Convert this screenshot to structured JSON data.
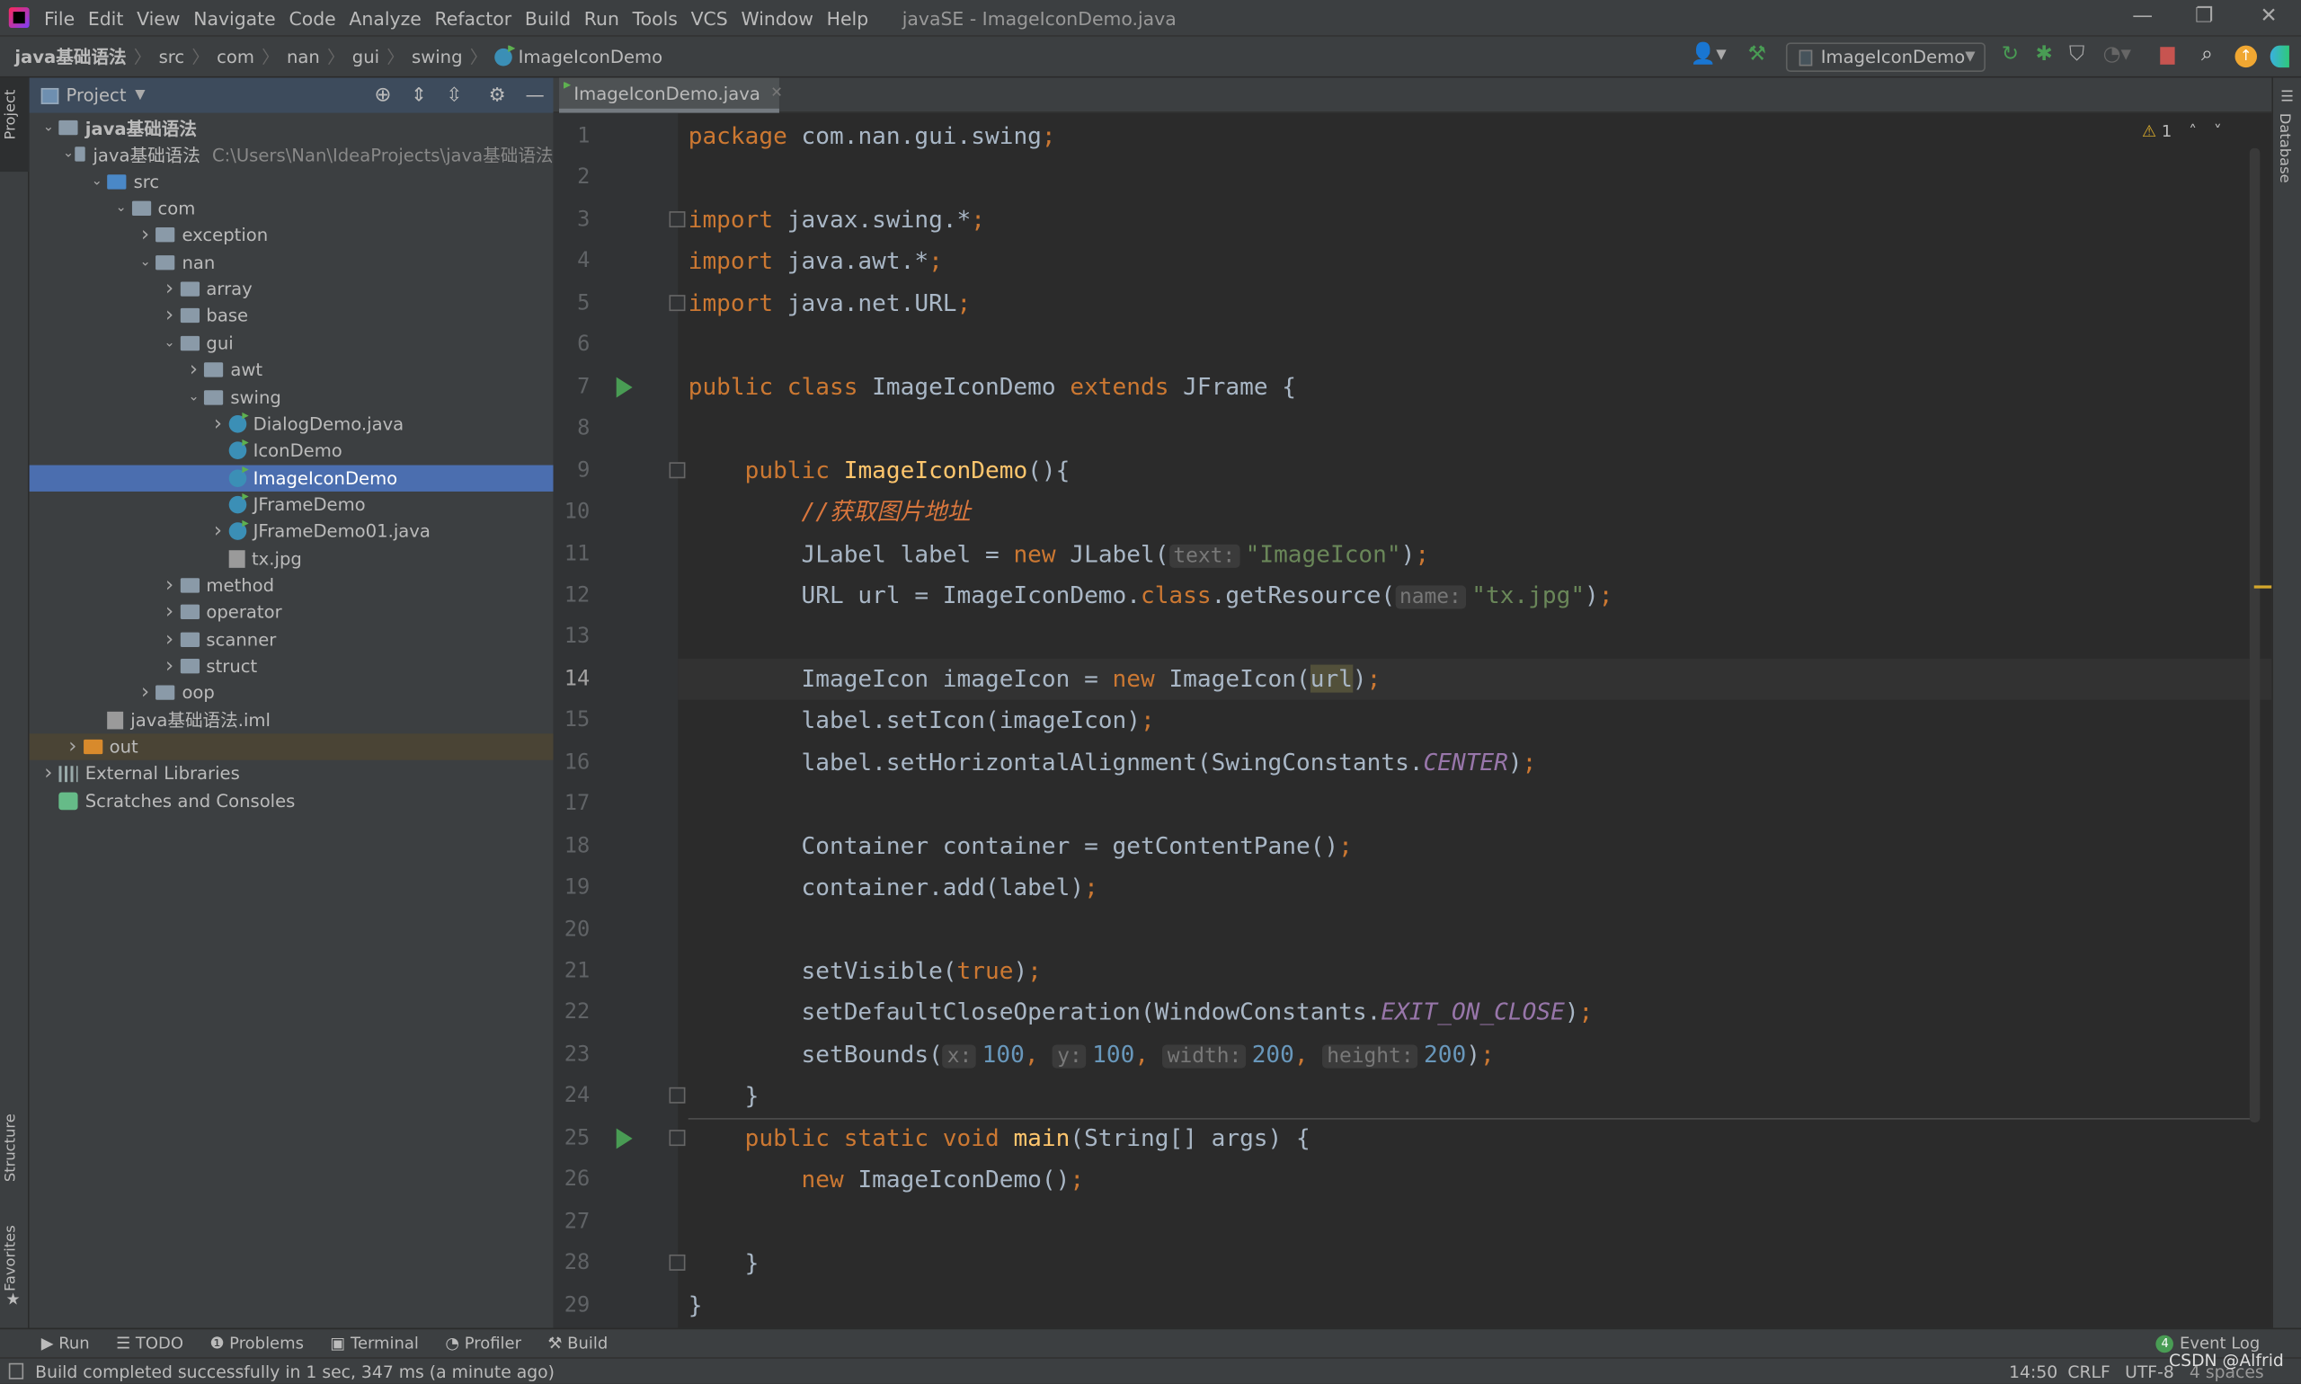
{
  "window": {
    "title": "javaSE - ImageIconDemo.java",
    "menu": [
      "File",
      "Edit",
      "View",
      "Navigate",
      "Code",
      "Analyze",
      "Refactor",
      "Build",
      "Run",
      "Tools",
      "VCS",
      "Window",
      "Help"
    ]
  },
  "breadcrumb": [
    "java基础语法",
    "src",
    "com",
    "nan",
    "gui",
    "swing",
    "ImageIconDemo"
  ],
  "toolbar": {
    "run_config": "ImageIconDemo",
    "accent": "#499c54",
    "stop_color": "#c75450",
    "update_color": "#f0a732"
  },
  "left_strip": {
    "project": "Project",
    "structure": "Structure",
    "favorites": "Favorites"
  },
  "right_strip": {
    "database": "Database"
  },
  "project": {
    "title": "Project",
    "tree": [
      {
        "label": "java基础语法",
        "depth": 0,
        "arrow": "open",
        "icon": "module-folder",
        "bold": true
      },
      {
        "label": "java基础语法",
        "sub": "C:\\Users\\Nan\\IdeaProjects\\java基础语法",
        "depth": 1,
        "arrow": "open",
        "icon": "module-folder"
      },
      {
        "label": "src",
        "depth": 2,
        "arrow": "open",
        "icon": "source-folder"
      },
      {
        "label": "com",
        "depth": 3,
        "arrow": "open",
        "icon": "package"
      },
      {
        "label": "exception",
        "depth": 4,
        "arrow": "closed",
        "icon": "package"
      },
      {
        "label": "nan",
        "depth": 4,
        "arrow": "open",
        "icon": "package"
      },
      {
        "label": "array",
        "depth": 5,
        "arrow": "closed",
        "icon": "package"
      },
      {
        "label": "base",
        "depth": 5,
        "arrow": "closed",
        "icon": "package"
      },
      {
        "label": "gui",
        "depth": 5,
        "arrow": "open",
        "icon": "package"
      },
      {
        "label": "awt",
        "depth": 6,
        "arrow": "closed",
        "icon": "package"
      },
      {
        "label": "swing",
        "depth": 6,
        "arrow": "open",
        "icon": "package"
      },
      {
        "label": "DialogDemo.java",
        "depth": 7,
        "arrow": "closed",
        "icon": "class"
      },
      {
        "label": "IconDemo",
        "depth": 7,
        "arrow": "",
        "icon": "class"
      },
      {
        "label": "ImageIconDemo",
        "depth": 7,
        "arrow": "",
        "icon": "class",
        "selected": true
      },
      {
        "label": "JFrameDemo",
        "depth": 7,
        "arrow": "",
        "icon": "class"
      },
      {
        "label": "JFrameDemo01.java",
        "depth": 7,
        "arrow": "closed",
        "icon": "class"
      },
      {
        "label": "tx.jpg",
        "depth": 7,
        "arrow": "",
        "icon": "image-file"
      },
      {
        "label": "method",
        "depth": 5,
        "arrow": "closed",
        "icon": "package"
      },
      {
        "label": "operator",
        "depth": 5,
        "arrow": "closed",
        "icon": "package"
      },
      {
        "label": "scanner",
        "depth": 5,
        "arrow": "closed",
        "icon": "package"
      },
      {
        "label": "struct",
        "depth": 5,
        "arrow": "closed",
        "icon": "package"
      },
      {
        "label": "oop",
        "depth": 4,
        "arrow": "closed",
        "icon": "package"
      },
      {
        "label": "java基础语法.iml",
        "depth": 2,
        "arrow": "",
        "icon": "iml-file"
      },
      {
        "label": "out",
        "depth": 1,
        "arrow": "closed",
        "icon": "excluded-folder",
        "out": true
      },
      {
        "label": "External Libraries",
        "depth": 0,
        "arrow": "closed",
        "icon": "library"
      },
      {
        "label": "Scratches and Consoles",
        "depth": 0,
        "arrow": "",
        "icon": "scratches"
      }
    ]
  },
  "editor": {
    "tab": "ImageIconDemo.java",
    "warnings": "1",
    "current_line": 14,
    "lines": [
      [
        [
          "package",
          "kw"
        ],
        [
          " com.nan.gui.swing",
          ""
        ],
        [
          ";",
          "kw"
        ]
      ],
      [],
      [
        [
          "import",
          "kw"
        ],
        [
          " javax.swing.*",
          ""
        ],
        [
          ";",
          "kw"
        ]
      ],
      [
        [
          "import",
          "kw"
        ],
        [
          " java.awt.*",
          ""
        ],
        [
          ";",
          "kw"
        ]
      ],
      [
        [
          "import",
          "kw"
        ],
        [
          " java.net.URL",
          ""
        ],
        [
          ";",
          "kw"
        ]
      ],
      [],
      [
        [
          "public class",
          "kw"
        ],
        [
          " ImageIconDemo ",
          ""
        ],
        [
          "extends",
          "kw"
        ],
        [
          " JFrame {",
          ""
        ]
      ],
      [],
      [
        [
          "    public ",
          "kw"
        ],
        [
          "ImageIconDemo",
          "fn"
        ],
        [
          "(){",
          ""
        ]
      ],
      [
        [
          "        //获取图片地址",
          "cm"
        ]
      ],
      [
        [
          "        JLabel label = ",
          ""
        ],
        [
          "new",
          "kw"
        ],
        [
          " JLabel(",
          ""
        ],
        [
          "text:",
          "hint"
        ],
        [
          "\"ImageIcon\"",
          "st"
        ],
        [
          ")",
          ""
        ],
        [
          ";",
          "kw"
        ]
      ],
      [
        [
          "        URL url = ImageIconDemo.",
          ""
        ],
        [
          "class",
          "kw"
        ],
        [
          ".getResource(",
          ""
        ],
        [
          "name:",
          "hint"
        ],
        [
          "\"tx.jpg\"",
          "st"
        ],
        [
          ")",
          ""
        ],
        [
          ";",
          "kw"
        ]
      ],
      [],
      [
        [
          "        ImageIcon imageIcon = ",
          ""
        ],
        [
          "new",
          "kw"
        ],
        [
          " ImageIcon(",
          ""
        ],
        [
          "url",
          "hl"
        ],
        [
          ")",
          ""
        ],
        [
          ";",
          "kw"
        ]
      ],
      [
        [
          "        label.setIcon(imageIcon)",
          ""
        ],
        [
          ";",
          "kw"
        ]
      ],
      [
        [
          "        label.setHorizontalAlignment(SwingConstants.",
          ""
        ],
        [
          "CENTER",
          "ic"
        ],
        [
          ")",
          ""
        ],
        [
          ";",
          "kw"
        ]
      ],
      [],
      [
        [
          "        Container container = getContentPane()",
          ""
        ],
        [
          ";",
          "kw"
        ]
      ],
      [
        [
          "        container.add(label)",
          ""
        ],
        [
          ";",
          "kw"
        ]
      ],
      [],
      [
        [
          "        setVisible(",
          ""
        ],
        [
          "true",
          "kw"
        ],
        [
          ")",
          ""
        ],
        [
          ";",
          "kw"
        ]
      ],
      [
        [
          "        setDefaultCloseOperation(WindowConstants.",
          ""
        ],
        [
          "EXIT_ON_CLOSE",
          "ic"
        ],
        [
          ")",
          ""
        ],
        [
          ";",
          "kw"
        ]
      ],
      [
        [
          "        setBounds(",
          ""
        ],
        [
          "x:",
          "hint"
        ],
        [
          "100",
          "nm"
        ],
        [
          ", ",
          "kw"
        ],
        [
          "y:",
          "hint"
        ],
        [
          "100",
          "nm"
        ],
        [
          ", ",
          "kw"
        ],
        [
          "width:",
          "hint"
        ],
        [
          "200",
          "nm"
        ],
        [
          ", ",
          "kw"
        ],
        [
          "height:",
          "hint"
        ],
        [
          "200",
          "nm"
        ],
        [
          ")",
          ""
        ],
        [
          ";",
          "kw"
        ]
      ],
      [
        [
          "    }",
          ""
        ]
      ],
      [
        [
          "    public static void ",
          "kw"
        ],
        [
          "main",
          "fn"
        ],
        [
          "(String[] args) {",
          ""
        ]
      ],
      [
        [
          "        ",
          ""
        ],
        [
          "new",
          "kw"
        ],
        [
          " ImageIconDemo()",
          ""
        ],
        [
          ";",
          "kw"
        ]
      ],
      [],
      [
        [
          "    }",
          ""
        ]
      ],
      [
        [
          "}",
          ""
        ]
      ]
    ]
  },
  "bottom_tools": [
    "Run",
    "TODO",
    "Problems",
    "Terminal",
    "Profiler",
    "Build"
  ],
  "event_log": {
    "label": "Event Log",
    "count": "4"
  },
  "status": {
    "message": "Build completed successfully in 1 sec, 347 ms (a minute ago)",
    "position": "14:50",
    "line_sep": "CRLF",
    "encoding": "UTF-8",
    "indent": "4 spaces",
    "watermark": "CSDN @Alfrid"
  }
}
